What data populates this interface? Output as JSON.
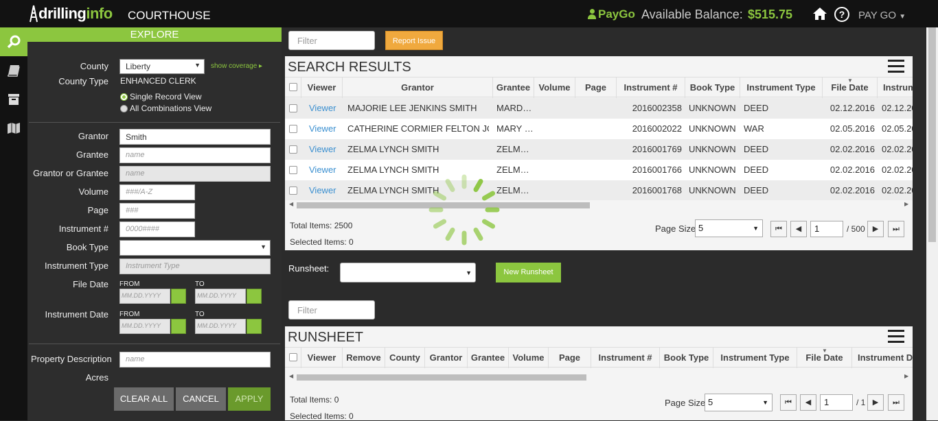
{
  "header": {
    "logo_a": "drilling",
    "logo_b": "info",
    "app_title": "COURTHOUSE",
    "paygo_label": "PayGo",
    "balance_label": "Available Balance:",
    "balance_value": "$515.75",
    "paygo_menu": "PAY GO"
  },
  "sidebar_icons": [
    "search-icon",
    "book-icon",
    "archive-icon",
    "map-icon"
  ],
  "explore": {
    "title": "EXPLORE",
    "county_label": "County",
    "county_value": "Liberty",
    "coverage_link": "show coverage",
    "county_type_label": "County Type",
    "county_type_value": "ENHANCED CLERK",
    "view_single": "Single Record View",
    "view_all": "All Combinations View",
    "grantor_label": "Grantor",
    "grantor_value": "Smith",
    "grantee_label": "Grantee",
    "grantee_ph": "name",
    "grantor_or_grantee_label": "Grantor or Grantee",
    "grantor_or_grantee_ph": "name",
    "volume_label": "Volume",
    "volume_ph": "###/A-Z",
    "page_label": "Page",
    "page_ph": "###",
    "instrument_num_label": "Instrument #",
    "instrument_num_ph": "0000####",
    "book_type_label": "Book Type",
    "book_type_value": "",
    "instrument_type_label": "Instrument Type",
    "instrument_type_ph": "Instrument Type",
    "file_date_label": "File Date",
    "instrument_date_label": "Instrument Date",
    "from_label": "FROM",
    "to_label": "TO",
    "date_ph": "MM.DD.YYYY",
    "property_desc_label": "Property Description",
    "property_desc_ph": "name",
    "acres_label": "Acres",
    "clear_all": "CLEAR ALL",
    "cancel": "CANCEL",
    "apply": "APPLY"
  },
  "results": {
    "filter_ph": "Filter",
    "report_issue": "Report Issue",
    "title": "SEARCH RESULTS",
    "columns": [
      "Viewer",
      "Grantor",
      "Grantee",
      "Volume",
      "Page",
      "Instrument #",
      "Book Type",
      "Instrument Type",
      "File Date",
      "Instrum"
    ],
    "rows": [
      {
        "viewer": "Viewer",
        "grantor": "MAJORIE LEE JENKINS SMITH",
        "grantee": "MARD…",
        "instrument": "2016002358",
        "book_type": "UNKNOWN",
        "instrument_type": "DEED",
        "file_date": "02.12.2016",
        "inst_date": "02.12.20"
      },
      {
        "viewer": "Viewer",
        "grantor": "CATHERINE CORMIER FELTON JO…",
        "grantee": "MARY …",
        "instrument": "2016002022",
        "book_type": "UNKNOWN",
        "instrument_type": "WAR",
        "file_date": "02.05.2016",
        "inst_date": "02.05.20"
      },
      {
        "viewer": "Viewer",
        "grantor": "ZELMA LYNCH SMITH",
        "grantee": "ZELM…",
        "instrument": "2016001769",
        "book_type": "UNKNOWN",
        "instrument_type": "DEED",
        "file_date": "02.02.2016",
        "inst_date": "02.02.20"
      },
      {
        "viewer": "Viewer",
        "grantor": "ZELMA LYNCH SMITH",
        "grantee": "ZELM…",
        "instrument": "2016001766",
        "book_type": "UNKNOWN",
        "instrument_type": "DEED",
        "file_date": "02.02.2016",
        "inst_date": "02.02.20"
      },
      {
        "viewer": "Viewer",
        "grantor": "ZELMA LYNCH SMITH",
        "grantee": "ZELM…",
        "instrument": "2016001768",
        "book_type": "UNKNOWN",
        "instrument_type": "DEED",
        "file_date": "02.02.2016",
        "inst_date": "02.02.20"
      }
    ],
    "total_items": "Total Items: 2500",
    "selected_items": "Selected Items: 0",
    "page_size_label": "Page Size:",
    "page_size": "5",
    "page": "1",
    "page_total": "/ 500"
  },
  "runsheet": {
    "label": "Runsheet:",
    "new_button": "New Runsheet",
    "filter_ph": "Filter",
    "title": "RUNSHEET",
    "columns": [
      "Viewer",
      "Remove",
      "County",
      "Grantor",
      "Grantee",
      "Volume",
      "Page",
      "Instrument #",
      "Book Type",
      "Instrument Type",
      "File Date",
      "Instrument D"
    ],
    "total_items": "Total Items: 0",
    "selected_items": "Selected Items: 0",
    "page_size_label": "Page Size:",
    "page_size": "5",
    "page": "1",
    "page_total": "/ 1"
  },
  "colors": {
    "accent": "#8cc63f",
    "link": "#3a8fd0",
    "report": "#f0a93e"
  }
}
